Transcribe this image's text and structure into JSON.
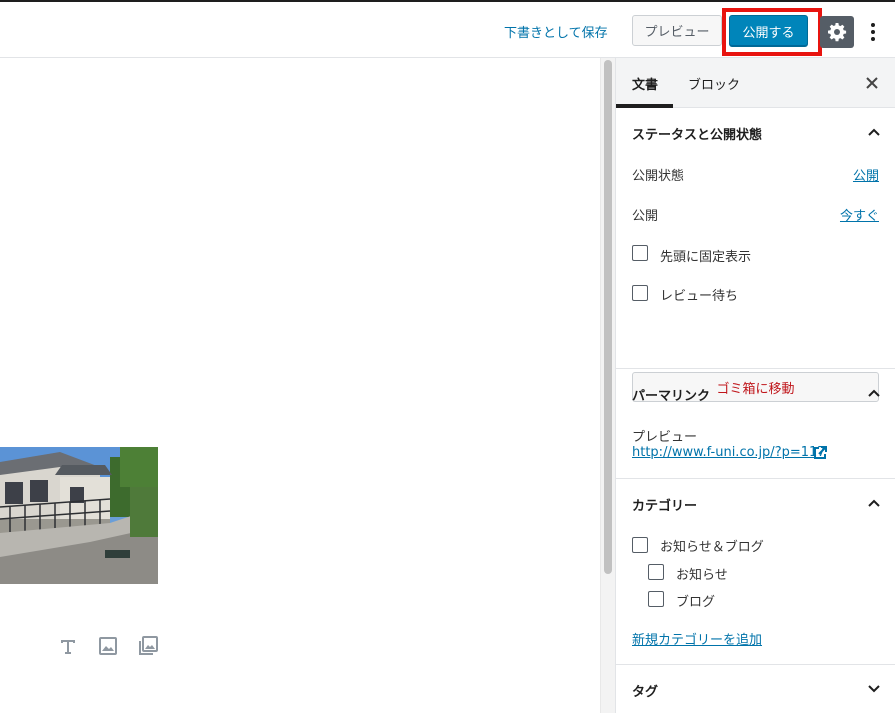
{
  "toolbar": {
    "save_draft": "下書きとして保存",
    "preview": "プレビュー",
    "publish": "公開する"
  },
  "sidebar": {
    "tabs": {
      "document": "文書",
      "block": "ブロック"
    },
    "status_panel": {
      "title": "ステータスと公開状態",
      "visibility_label": "公開状態",
      "visibility_value": "公開",
      "publish_label": "公開",
      "publish_value": "今すぐ",
      "sticky_label": "先頭に固定表示",
      "pending_label": "レビュー待ち",
      "trash_label": "ゴミ箱に移動"
    },
    "permalink_panel": {
      "title": "パーマリンク",
      "preview_label": "プレビュー",
      "url": "http://www.f-uni.co.jp/?p=117"
    },
    "category_panel": {
      "title": "カテゴリー",
      "items": [
        "お知らせ＆ブログ",
        "お知らせ",
        "ブログ"
      ],
      "add_link": "新規カテゴリーを追加"
    },
    "tag_panel": {
      "title": "タグ"
    }
  },
  "colors": {
    "accent": "#0085ba",
    "link": "#0073aa",
    "highlight": "#e8140f",
    "danger": "#c0161b"
  },
  "icons": [
    "gear-icon",
    "more-vertical-icon",
    "close-icon",
    "chevron-up-icon",
    "chevron-down-icon",
    "external-link-icon",
    "text-icon",
    "image-icon",
    "gallery-icon"
  ]
}
